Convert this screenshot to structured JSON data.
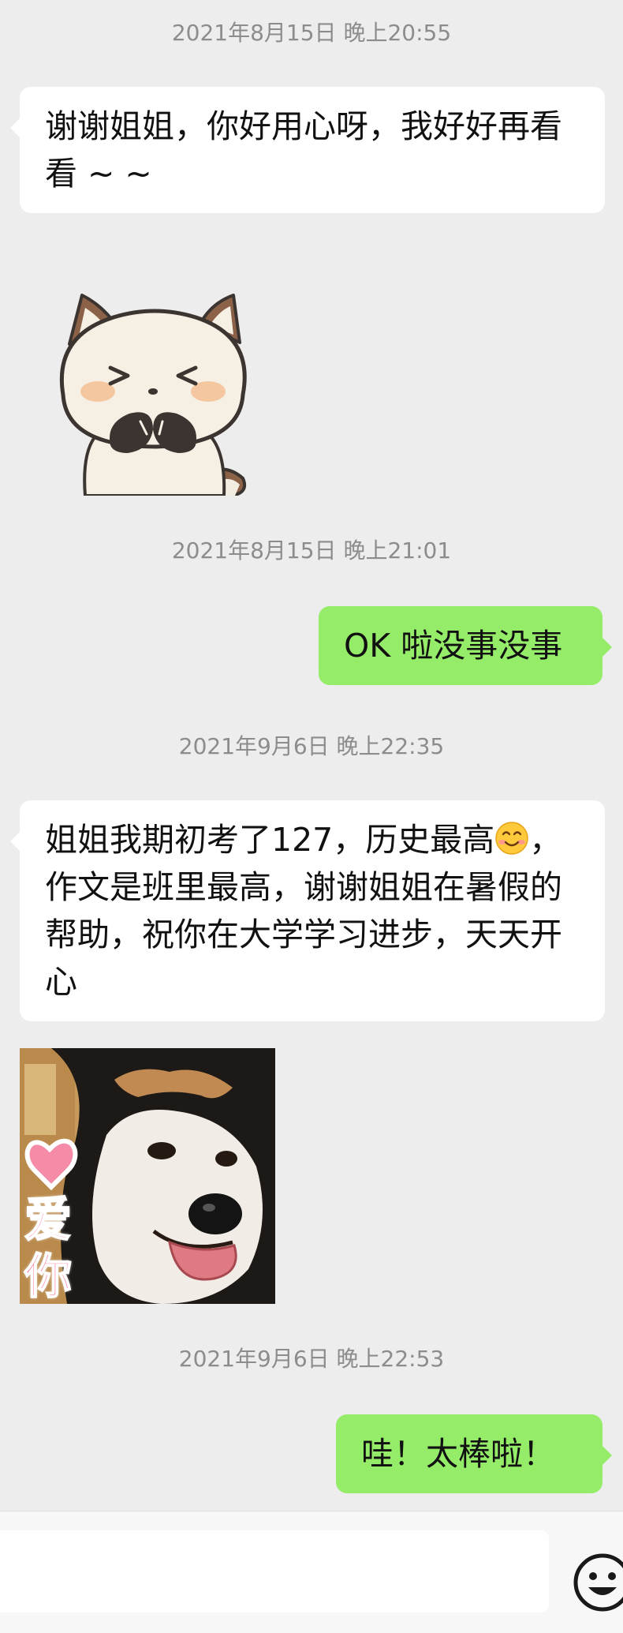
{
  "messages": [
    {
      "time": "2021年8月15日 晚上20:55"
    },
    {
      "text": "谢谢姐姐，你好用心呀，我好好再看看 ~ ~"
    },
    {
      "time": "2021年8月15日 晚上21:01"
    },
    {
      "text": "OK 啦没事没事"
    },
    {
      "time": "2021年9月6日 晚上22:35"
    },
    {
      "text_a": "姐姐我期初考了127，历史最高",
      "text_b": "，作文是班里最高，谢谢姐姐在暑假的帮助，祝你在大学学习进步，天天开心"
    },
    {
      "sticker_text": "爱你"
    },
    {
      "time": "2021年9月6日 晚上22:53"
    },
    {
      "text": "哇！太棒啦！"
    }
  ],
  "icons": {
    "inline_emoji": "smiling-face-emoji",
    "input_emoji": "smiley-face-icon",
    "sticker_1": "cartoon-dog-covering-mouth-sticker",
    "sticker_2": "shiba-dog-love-sticker"
  },
  "colors": {
    "background": "#ededed",
    "bubble_received": "#ffffff",
    "bubble_sent": "#95ec69",
    "timestamp": "#8c8c8c"
  }
}
